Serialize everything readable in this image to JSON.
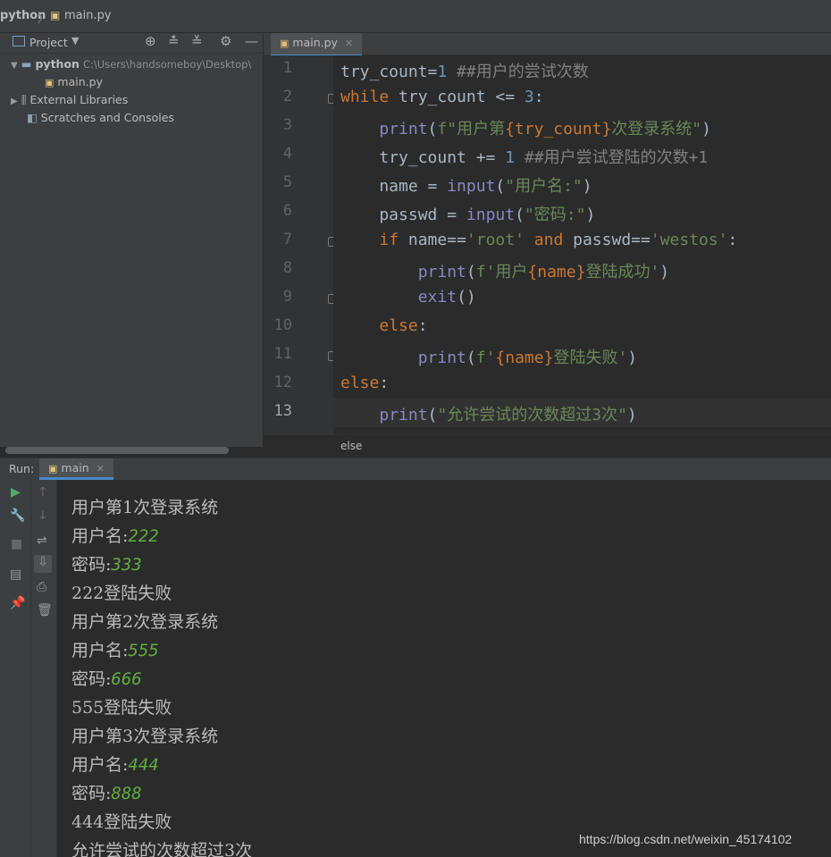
{
  "breadcrumb": {
    "project": "python",
    "file": "main.py"
  },
  "project_panel": {
    "title": "Project",
    "root": {
      "name": "python",
      "path": "C:\\Users\\handsomeboy\\Desktop\\"
    },
    "file": "main.py",
    "external": "External Libraries",
    "scratches": "Scratches and Consoles"
  },
  "editor": {
    "tab": "main.py",
    "lines": [
      "1",
      "2",
      "3",
      "4",
      "5",
      "6",
      "7",
      "8",
      "9",
      "10",
      "11",
      "12",
      "13"
    ],
    "code": {
      "l1a": "try_count=",
      "l1b": "1",
      "l1c": " ##用户的尝试次数",
      "l2a": "while",
      "l2b": " try_count <= ",
      "l2c": "3",
      "l2d": ":",
      "l3a": "    ",
      "l3b": "print",
      "l3c": "(",
      "l3d": "f\"用户第",
      "l3e": "{try_count}",
      "l3f": "次登录系统\"",
      "l3g": ")",
      "l4a": "    try_count += ",
      "l4b": "1",
      "l4c": " ##用户尝试登陆的次数+1",
      "l5a": "    name = ",
      "l5b": "input",
      "l5c": "(",
      "l5d": "\"用户名:\"",
      "l5e": ")",
      "l6a": "    passwd = ",
      "l6b": "input",
      "l6c": "(",
      "l6d": "\"密码:\"",
      "l6e": ")",
      "l7a": "    ",
      "l7b": "if",
      "l7c": " name==",
      "l7d": "'root'",
      "l7e": " and",
      "l7f": " passwd==",
      "l7g": "'westos'",
      "l7h": ":",
      "l8a": "        ",
      "l8b": "print",
      "l8c": "(",
      "l8d": "f'用户",
      "l8e": "{name}",
      "l8f": "登陆成功'",
      "l8g": ")",
      "l9a": "        ",
      "l9b": "exit",
      "l9c": "()",
      "l10a": "    ",
      "l10b": "else",
      "l10c": ":",
      "l11a": "        ",
      "l11b": "print",
      "l11c": "(",
      "l11d": "f'",
      "l11e": "{name}",
      "l11f": "登陆失败'",
      "l11g": ")",
      "l12a": "else",
      "l12b": ":",
      "l13a": "    ",
      "l13b": "print",
      "l13c": "(",
      "l13d": "\"允许尝试的次数超过3次\"",
      "l13e": ")"
    },
    "status": "else"
  },
  "run": {
    "label": "Run:",
    "tab": "main",
    "output": [
      {
        "t": "用户第1次登录系统",
        "i": ""
      },
      {
        "t": "用户名:",
        "i": "222"
      },
      {
        "t": "密码:",
        "i": "333"
      },
      {
        "t": "222登陆失败",
        "i": ""
      },
      {
        "t": "用户第2次登录系统",
        "i": ""
      },
      {
        "t": "用户名:",
        "i": "555"
      },
      {
        "t": "密码:",
        "i": "666"
      },
      {
        "t": "555登陆失败",
        "i": ""
      },
      {
        "t": "用户第3次登录系统",
        "i": ""
      },
      {
        "t": "用户名:",
        "i": "444"
      },
      {
        "t": "密码:",
        "i": "888"
      },
      {
        "t": "444登陆失败",
        "i": ""
      },
      {
        "t": "允许尝试的次数超过3次",
        "i": ""
      }
    ]
  },
  "watermark": "https://blog.csdn.net/weixin_45174102"
}
